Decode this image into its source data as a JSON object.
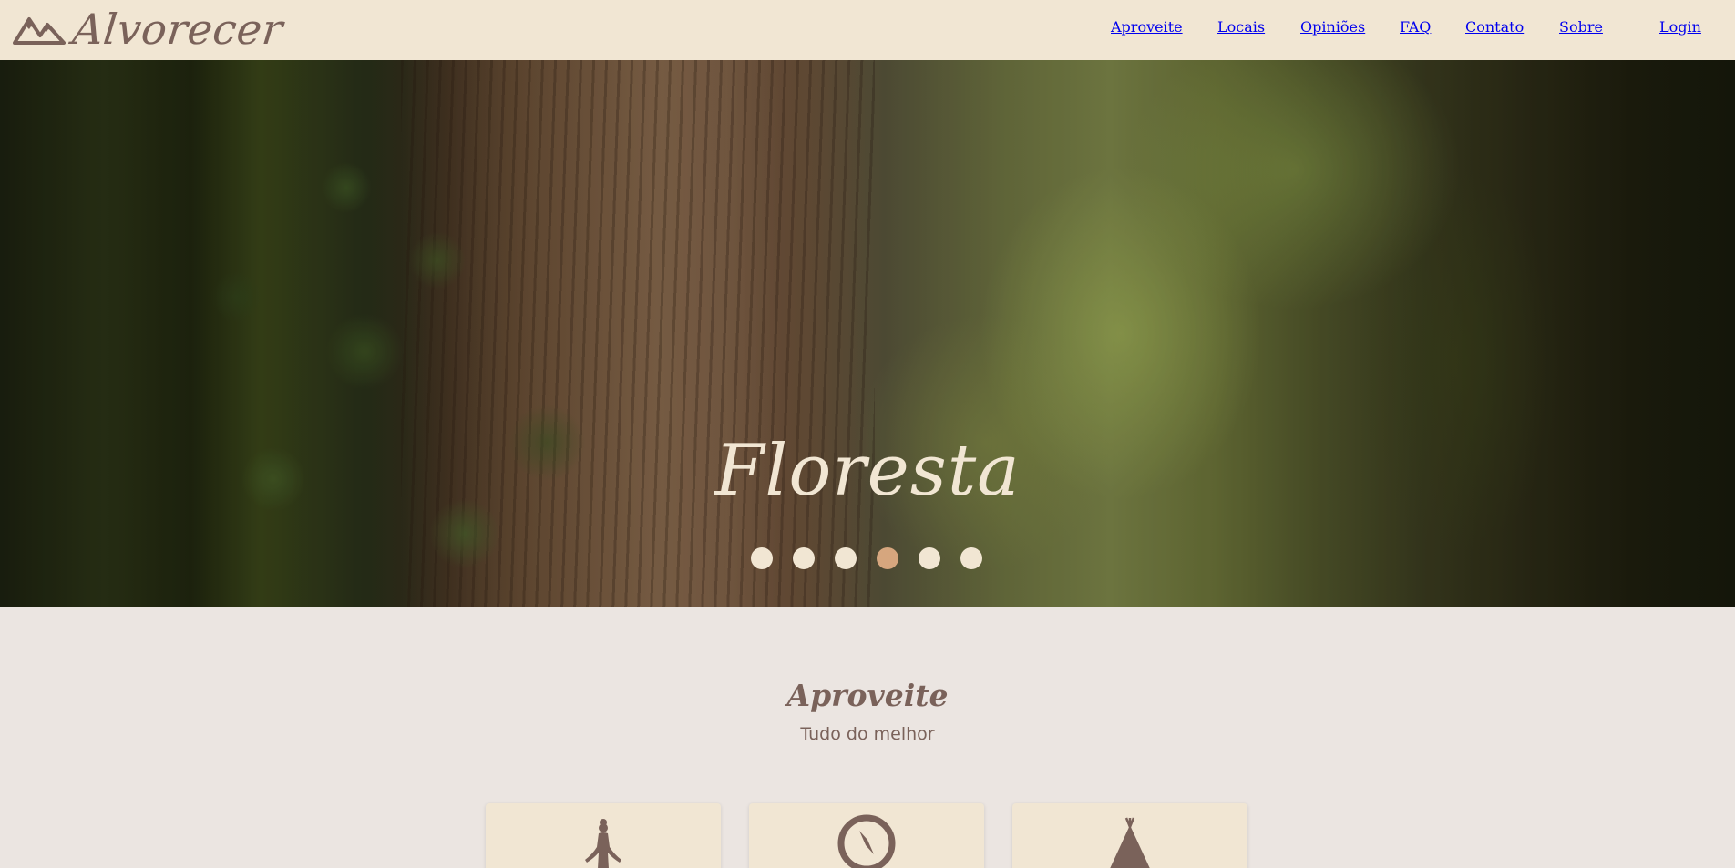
{
  "brand": {
    "name": "Alvorecer",
    "logo_icon": "mountains-icon"
  },
  "nav": {
    "items": [
      {
        "label": "Aproveite"
      },
      {
        "label": "Locais"
      },
      {
        "label": "Opiniões"
      },
      {
        "label": "FAQ"
      },
      {
        "label": "Contato"
      },
      {
        "label": "Sobre"
      }
    ],
    "login_label": "Login"
  },
  "hero": {
    "title": "Floresta",
    "slide_count": 6,
    "active_slide": 4
  },
  "section": {
    "title": "Aproveite",
    "subtitle": "Tudo do melhor",
    "cards": [
      {
        "icon": "meditation-icon"
      },
      {
        "icon": "compass-icon"
      },
      {
        "icon": "tent-icon"
      }
    ]
  },
  "colors": {
    "header_bg": "#f1e6d3",
    "page_bg": "#ebe5e1",
    "text_brown": "#7a625a",
    "dot_active": "#d6a67e",
    "dot_inactive": "#f1e6d3"
  }
}
